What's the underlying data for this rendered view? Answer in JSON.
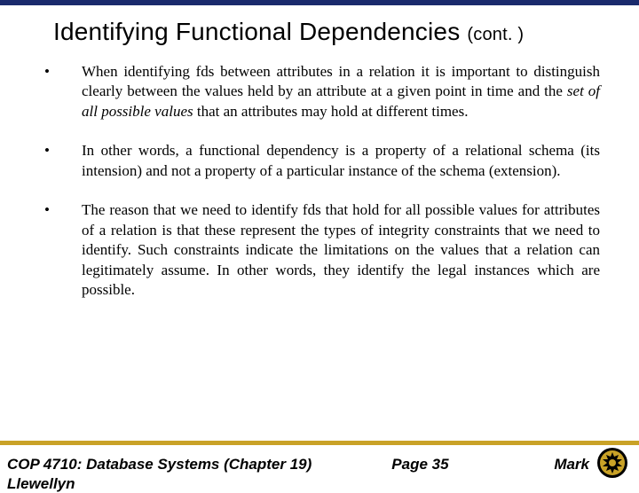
{
  "title": {
    "main": "Identifying Functional Dependencies",
    "cont": "(cont. )"
  },
  "bullets": [
    {
      "pre": "When identifying fds between attributes in a relation it is important to distinguish clearly between the values held by an attribute at a given point in time and the ",
      "em": "set of all possible values",
      "post": " that an attributes may hold at different times."
    },
    {
      "pre": "In other words, a functional dependency is a property of a relational schema (its intension) and not a property of a particular instance of the schema (extension).",
      "em": "",
      "post": ""
    },
    {
      "pre": "The reason that we need to identify fds that hold for all possible values for attributes of a relation is that these represent the types of integrity constraints that we need to identify.  Such constraints indicate the limitations on the values that a relation can legitimately assume.  In other words, they identify the legal instances which are possible.",
      "em": "",
      "post": ""
    }
  ],
  "footer": {
    "course": "COP 4710: Database Systems  (Chapter 19)",
    "page": "Page 35",
    "author": "Mark",
    "author_cut": "Llewellyn"
  }
}
